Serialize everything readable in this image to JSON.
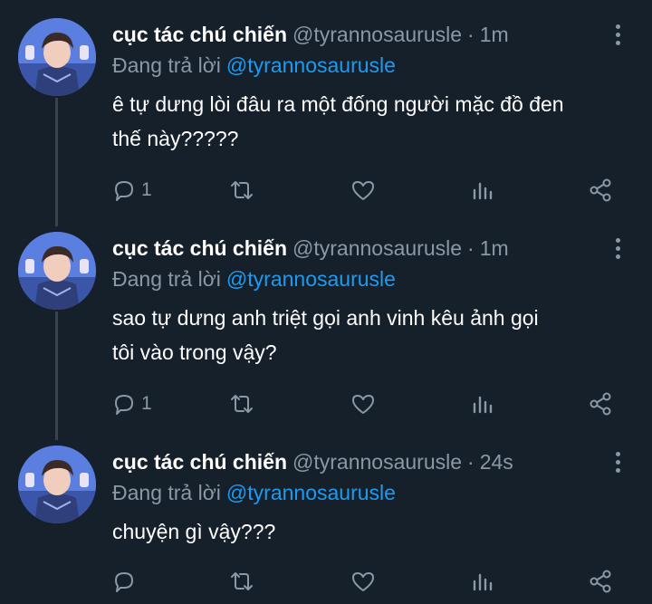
{
  "tweets": [
    {
      "name": "cục tác chú chiến",
      "handle": "@tyrannosaurusle",
      "separator": "·",
      "time": "1m",
      "reply_label": "Đang trả lời",
      "reply_to": "@tyrannosaurusle",
      "text_lines": [
        "ê tự dưng lòi đâu ra một đống người mặc đồ đen",
        "thế này?????"
      ],
      "reply_count": "1",
      "retweet_count": "",
      "like_count": ""
    },
    {
      "name": "cục tác chú chiến",
      "handle": "@tyrannosaurusle",
      "separator": "·",
      "time": "1m",
      "reply_label": "Đang trả lời",
      "reply_to": "@tyrannosaurusle",
      "text_lines": [
        "sao tự dưng anh triệt gọi anh vinh kêu ảnh gọi",
        "tôi vào trong vậy?"
      ],
      "reply_count": "1",
      "retweet_count": "",
      "like_count": ""
    },
    {
      "name": "cục tác chú chiến",
      "handle": "@tyrannosaurusle",
      "separator": "·",
      "time": "24s",
      "reply_label": "Đang trả lời",
      "reply_to": "@tyrannosaurusle",
      "text_lines": [
        "chuyện gì vậy???"
      ],
      "reply_count": "",
      "retweet_count": "",
      "like_count": ""
    }
  ],
  "icons": {
    "reply": "reply-icon",
    "retweet": "retweet-icon",
    "like": "heart-icon",
    "analytics": "analytics-icon",
    "share": "share-icon",
    "more": "more-options-icon"
  },
  "colors": {
    "background": "#15202b",
    "text": "#ffffff",
    "secondary": "#8b98a5",
    "link": "#1d9bf0",
    "thread_line": "#38444d"
  }
}
